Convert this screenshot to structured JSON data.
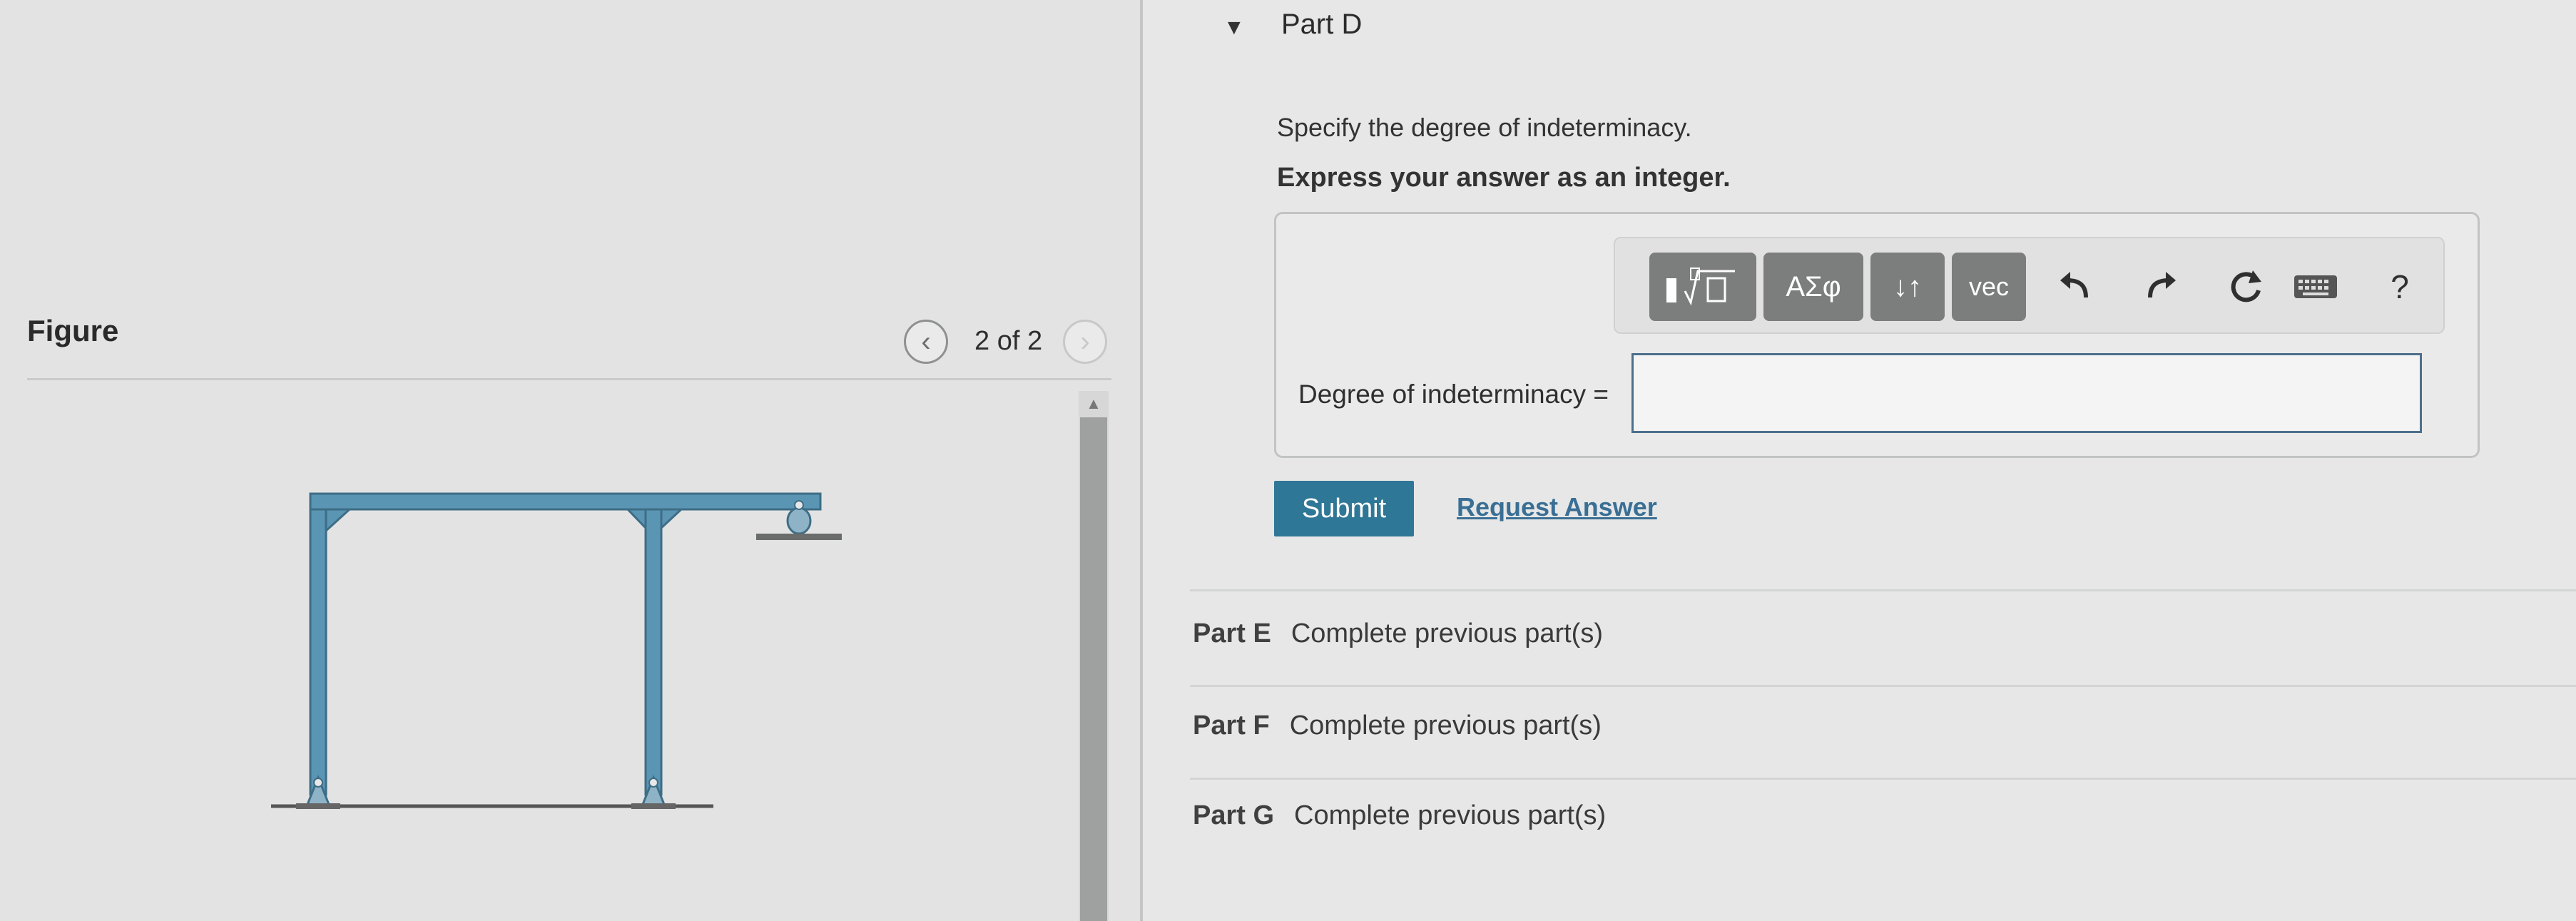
{
  "figure": {
    "title": "Figure",
    "page_indicator": "2 of 2",
    "prev_icon": "chevron-left-icon",
    "next_icon": "chevron-right-icon"
  },
  "part_d": {
    "title": "Part D",
    "question": "Specify the degree of indeterminacy.",
    "instruction": "Express your answer as an integer.",
    "toolbar": {
      "greek_label": "ΑΣφ",
      "arrows_label": "↓↑",
      "vec_label": "vec",
      "help_label": "?"
    },
    "answer_label": "Degree of indeterminacy =",
    "answer_value": "",
    "submit_label": "Submit",
    "request_answer_label": "Request Answer"
  },
  "parts": [
    {
      "label": "Part E",
      "status": "Complete previous part(s)"
    },
    {
      "label": "Part F",
      "status": "Complete previous part(s)"
    },
    {
      "label": "Part G",
      "status": "Complete previous part(s)"
    }
  ],
  "colors": {
    "accent": "#2f7797",
    "frame": "#5b95b4",
    "toolbar_button": "#7c7e7d",
    "link": "#3a6f95"
  }
}
